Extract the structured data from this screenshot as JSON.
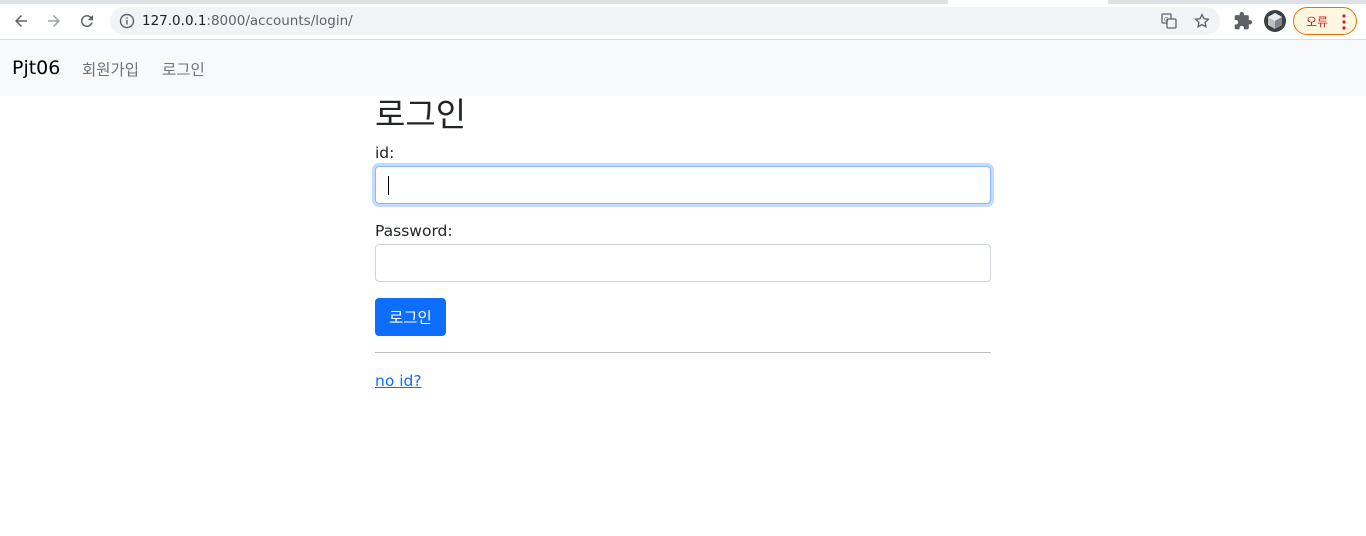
{
  "browser": {
    "url_host": "127.0.0.1",
    "url_path": ":8000/accounts/login/",
    "error_badge": "오류"
  },
  "navbar": {
    "brand": "Pjt06",
    "links": [
      "회원가입",
      "로그인"
    ]
  },
  "main": {
    "title": "로그인",
    "id_label": "id:",
    "id_value": "",
    "password_label": "Password:",
    "password_value": "",
    "submit_label": "로그인",
    "signup_link": "no id?"
  },
  "colors": {
    "primary": "#0d6efd",
    "navbar_bg": "#f8f9fa",
    "error_accent": "#e8710a"
  }
}
